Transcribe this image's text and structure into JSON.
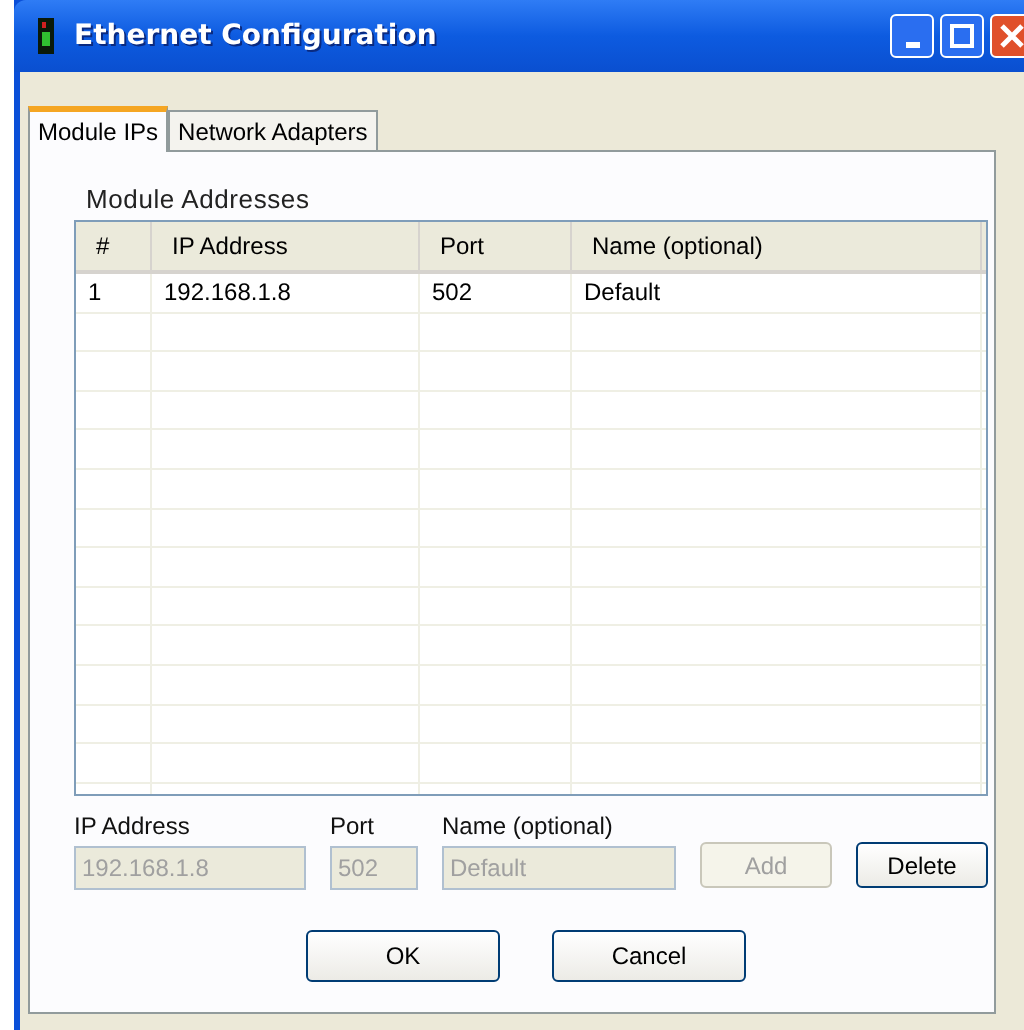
{
  "window": {
    "title": "Ethernet Configuration"
  },
  "tabs": [
    {
      "label": "Module IPs",
      "selected": true
    },
    {
      "label": "Network Adapters",
      "selected": false
    }
  ],
  "group": {
    "title": "Module Addresses"
  },
  "table": {
    "columns": [
      "#",
      "IP Address",
      "Port",
      "Name (optional)"
    ],
    "rows": [
      {
        "cells": [
          "1",
          "192.168.1.8",
          "502",
          "Default"
        ]
      }
    ]
  },
  "form": {
    "fields": [
      {
        "label": "IP Address",
        "value": "192.168.1.8",
        "disabled": true
      },
      {
        "label": "Port",
        "value": "502",
        "disabled": true
      },
      {
        "label": "Name (optional)",
        "value": "Default",
        "disabled": true
      }
    ],
    "buttons": [
      {
        "label": "Add",
        "disabled": true
      },
      {
        "label": "Delete",
        "disabled": false
      }
    ]
  },
  "dialog_buttons": [
    "OK",
    "Cancel"
  ]
}
